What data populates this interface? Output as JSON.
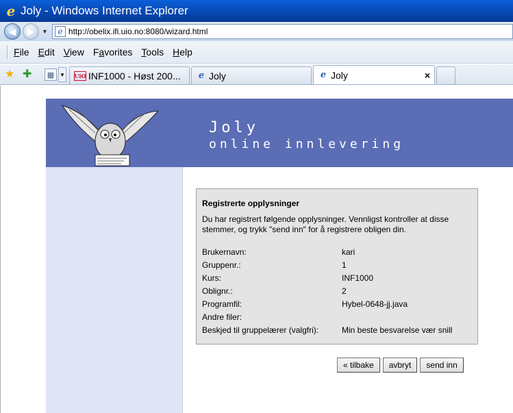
{
  "window": {
    "title": "Joly - Windows Internet Explorer"
  },
  "address": {
    "url": "http://obelix.ifi.uio.no:8080/wizard.html"
  },
  "menu": [
    {
      "label": "File",
      "key": "F"
    },
    {
      "label": "Edit",
      "key": "E"
    },
    {
      "label": "View",
      "key": "V"
    },
    {
      "label": "Favorites",
      "key": "a"
    },
    {
      "label": "Tools",
      "key": "T"
    },
    {
      "label": "Help",
      "key": "H"
    }
  ],
  "tabs": [
    {
      "label": "INF1000 - Høst 200...",
      "icon": "uio-icon"
    },
    {
      "label": "Joly",
      "icon": "ie-page-icon"
    },
    {
      "label": "Joly",
      "icon": "ie-page-icon",
      "active": true
    }
  ],
  "banner": {
    "title": "Joly",
    "subtitle": "online innlevering"
  },
  "panel": {
    "heading": "Registrerte opplysninger",
    "intro": "Du har registrert følgende opplysninger. Vennligst kontroller at disse stemmer, og trykk \"send inn\" for å registrere obligen din.",
    "fields": [
      {
        "label": "Brukernavn:",
        "value": "kari"
      },
      {
        "label": "Gruppenr.:",
        "value": "1"
      },
      {
        "label": "Kurs:",
        "value": "INF1000"
      },
      {
        "label": "Oblignr.:",
        "value": "2"
      },
      {
        "label": "Programfil:",
        "value": "Hybel-0648-jj.java"
      },
      {
        "label": "Andre filer:",
        "value": ""
      },
      {
        "label": "Beskjed til gruppelærer (valgfri):",
        "value": "Min beste besvarelse vær snill"
      }
    ]
  },
  "buttons": {
    "back": "« tilbake",
    "cancel": "avbryt",
    "submit": "send inn"
  }
}
